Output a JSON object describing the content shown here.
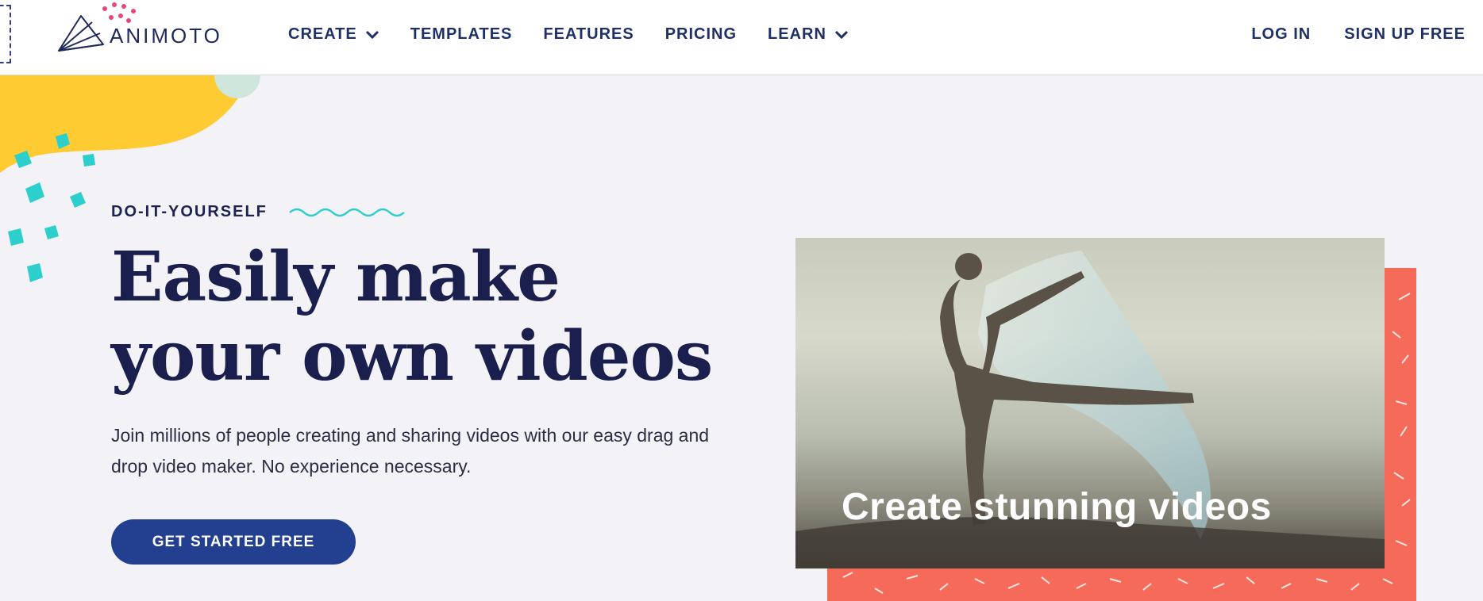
{
  "brand": {
    "name": "ANIMOTO"
  },
  "nav": {
    "items": [
      {
        "label": "CREATE",
        "has_dropdown": true
      },
      {
        "label": "TEMPLATES",
        "has_dropdown": false
      },
      {
        "label": "FEATURES",
        "has_dropdown": false
      },
      {
        "label": "PRICING",
        "has_dropdown": false
      },
      {
        "label": "LEARN",
        "has_dropdown": true
      }
    ],
    "login": "LOG IN",
    "signup": "SIGN UP FREE"
  },
  "hero": {
    "eyebrow": "DO-IT-YOURSELF",
    "headline": "Easily make your own videos",
    "subtext": "Join millions of people creating and sharing videos with our easy drag and drop video maker. No experience necessary.",
    "cta": "GET STARTED FREE"
  },
  "media": {
    "caption": "Create stunning videos",
    "icon": "dancer-photo"
  },
  "colors": {
    "navy": "#1f3068",
    "heading": "#1a1f4e",
    "cta_bg": "#233f8f",
    "yellow": "#ffcb32",
    "teal": "#2ccfcb",
    "coral": "#f56a58",
    "pink": "#e8457a",
    "background": "#f2f2f7"
  }
}
